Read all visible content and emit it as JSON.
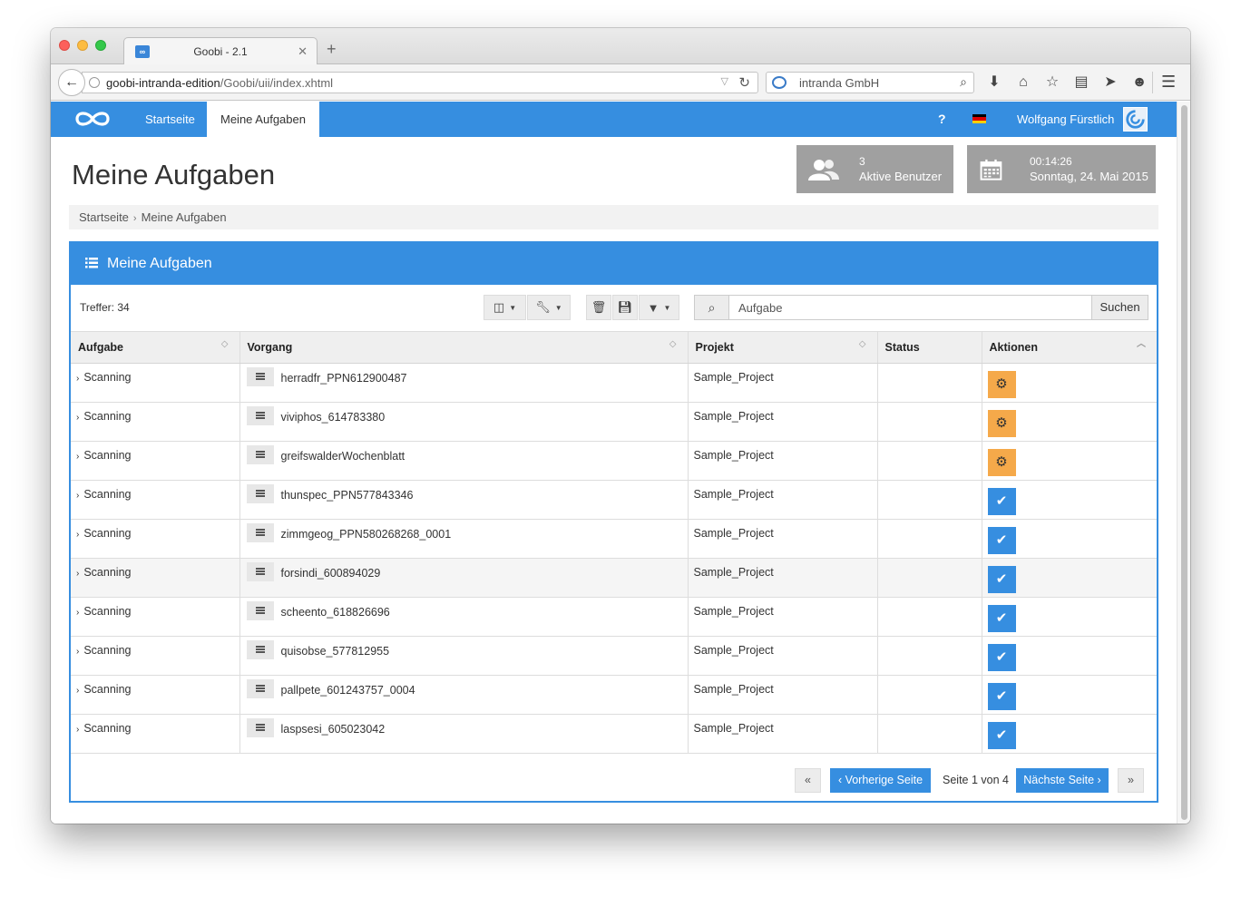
{
  "browser": {
    "tab_title": "Goobi - 2.1",
    "tab_favicon": "∞",
    "url_host": "goobi-intranda-edition",
    "url_path": "/Goobi/uii/index.xhtml",
    "search_engine": "intranda GmbH"
  },
  "appnav": {
    "items": [
      "Startseite",
      "Meine Aufgaben"
    ],
    "active_index": 1,
    "help": "?",
    "user": "Wolfgang Fürstlich"
  },
  "header": {
    "title": "Meine Aufgaben",
    "stats": {
      "users_count": "3",
      "users_label": "Aktive Benutzer",
      "time": "00:14:26",
      "date": "Sonntag, 24. Mai 2015"
    }
  },
  "breadcrumb": [
    "Startseite",
    "Meine Aufgaben"
  ],
  "box": {
    "title": "Meine Aufgaben",
    "hits": "Treffer: 34",
    "search_placeholder": "Aufgabe",
    "search_button": "Suchen"
  },
  "table": {
    "columns": [
      "Aufgabe",
      "Vorgang",
      "Projekt",
      "Status",
      "Aktionen"
    ],
    "rows": [
      {
        "task": "Scanning",
        "process": "herradfr_PPN612900487",
        "project": "Sample_Project",
        "status": "",
        "action": "open"
      },
      {
        "task": "Scanning",
        "process": "viviphos_614783380",
        "project": "Sample_Project",
        "status": "",
        "action": "open"
      },
      {
        "task": "Scanning",
        "process": "greifswalderWochenblatt",
        "project": "Sample_Project",
        "status": "",
        "action": "open"
      },
      {
        "task": "Scanning",
        "process": "thunspec_PPN577843346",
        "project": "Sample_Project",
        "status": "",
        "action": "done"
      },
      {
        "task": "Scanning",
        "process": "zimmgeog_PPN580268268_0001",
        "project": "Sample_Project",
        "status": "",
        "action": "done"
      },
      {
        "task": "Scanning",
        "process": "forsindi_600894029",
        "project": "Sample_Project",
        "status": "",
        "action": "done"
      },
      {
        "task": "Scanning",
        "process": "scheento_618826696",
        "project": "Sample_Project",
        "status": "",
        "action": "done"
      },
      {
        "task": "Scanning",
        "process": "quisobse_577812955",
        "project": "Sample_Project",
        "status": "",
        "action": "done"
      },
      {
        "task": "Scanning",
        "process": "pallpete_601243757_0004",
        "project": "Sample_Project",
        "status": "",
        "action": "done"
      },
      {
        "task": "Scanning",
        "process": "laspsesi_605023042",
        "project": "Sample_Project",
        "status": "",
        "action": "done"
      }
    ]
  },
  "pagination": {
    "first": "«",
    "prev": "‹ Vorherige Seite",
    "info": "Seite 1 von 4",
    "next": "Nächste Seite ›",
    "last": "»"
  },
  "colors": {
    "accent": "#368ee0",
    "action_open": "#f5a94a",
    "stat_box": "#a0a0a0"
  },
  "icons": {
    "action_open": "gear-icon",
    "action_done": "check-icon"
  }
}
